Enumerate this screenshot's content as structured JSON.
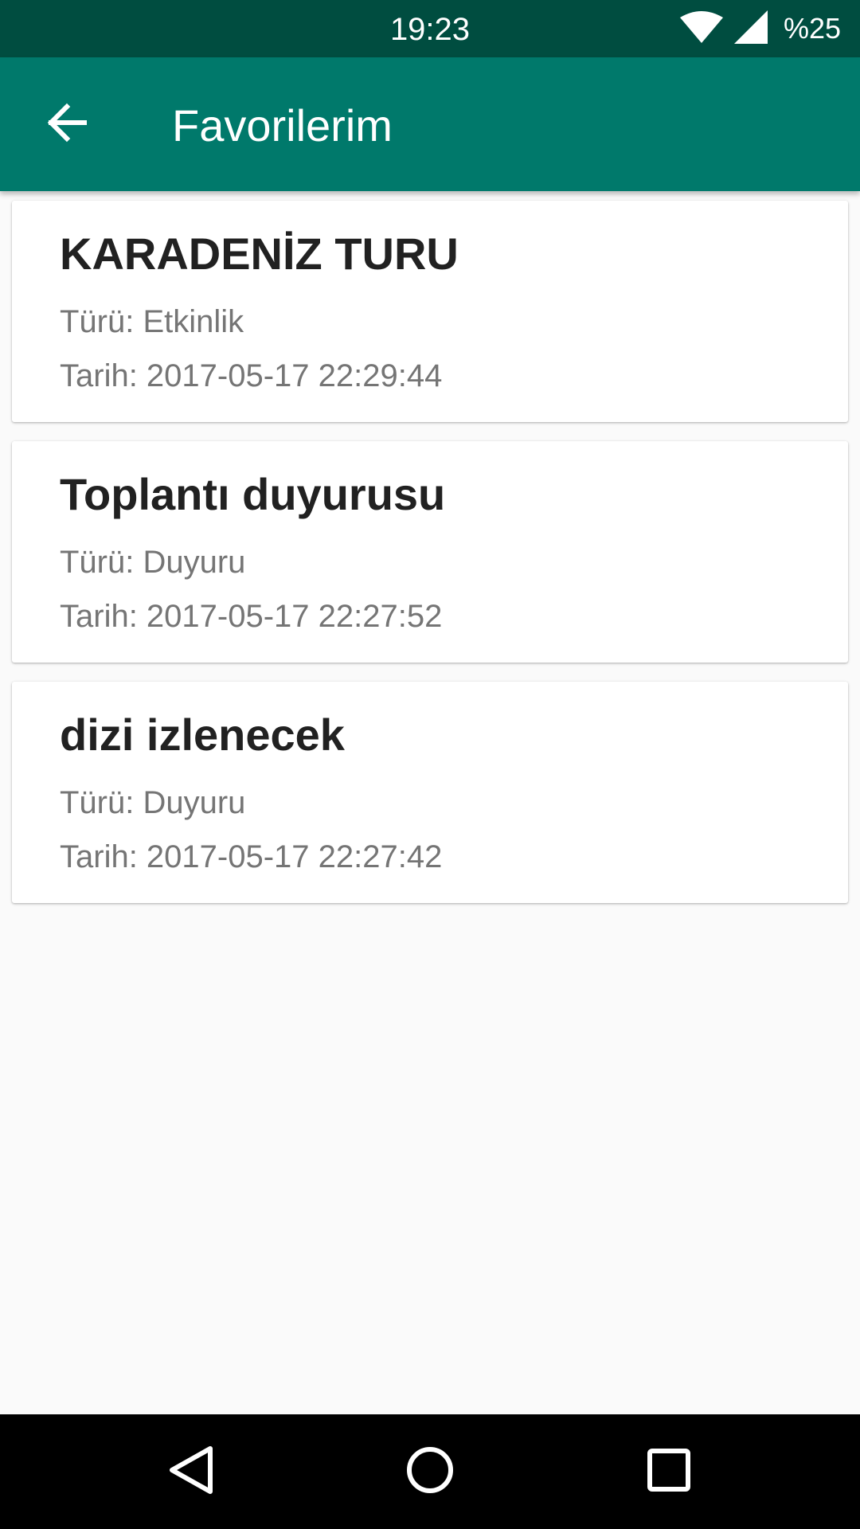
{
  "status_bar": {
    "time": "19:23",
    "battery": "%25",
    "icons": [
      "wifi-icon",
      "signal-icon"
    ]
  },
  "app_bar": {
    "title": "Favorilerim",
    "back_icon": "arrow-back-icon",
    "background_color": "#00796b"
  },
  "favorites": [
    {
      "title": "KARADENİZ TURU",
      "type": "Türü: Etkinlik",
      "date": "Tarih: 2017-05-17 22:29:44"
    },
    {
      "title": "Toplantı duyurusu",
      "type": "Türü: Duyuru",
      "date": "Tarih: 2017-05-17 22:27:52"
    },
    {
      "title": "dizi izlenecek",
      "type": "Türü: Duyuru",
      "date": "Tarih: 2017-05-17 22:27:42"
    }
  ],
  "nav_bar": {
    "icons": [
      "nav-back-icon",
      "nav-home-icon",
      "nav-recents-icon"
    ]
  },
  "colors": {
    "status_bar": "#004d40",
    "primary": "#00796b",
    "background": "#fafafa"
  }
}
